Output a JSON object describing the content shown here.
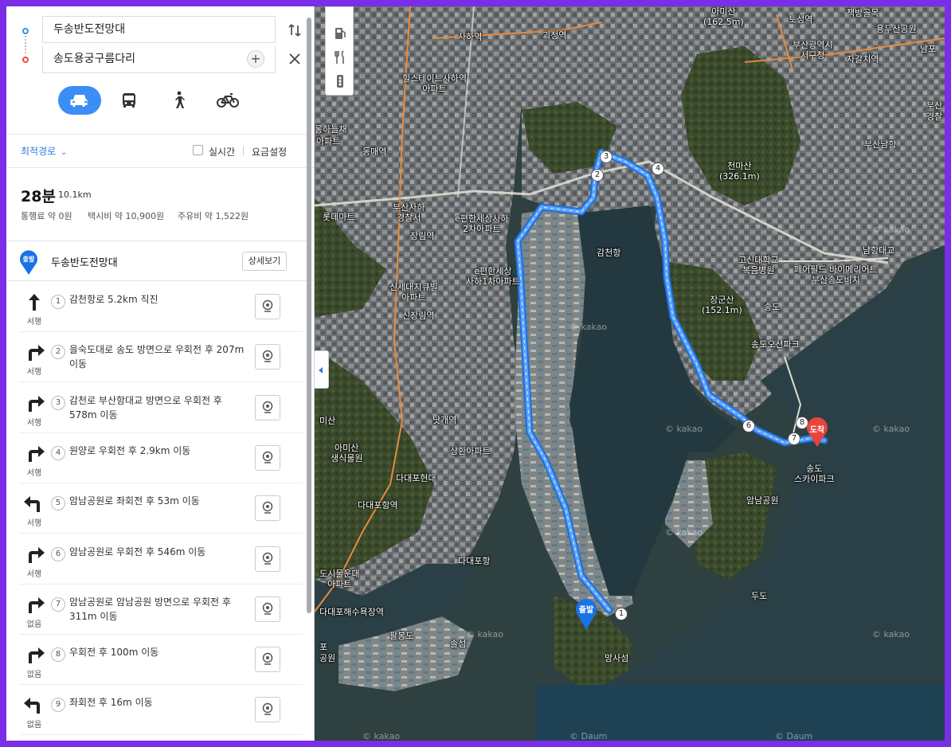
{
  "search": {
    "origin": "두송반도전망대",
    "destination": "송도용궁구름다리"
  },
  "modes": [
    "car",
    "bus",
    "walk",
    "bike"
  ],
  "options": {
    "route_type": "최적경로",
    "realtime": "실시간",
    "fare_settings": "요금설정"
  },
  "summary": {
    "time": "28분",
    "distance": "10.1km",
    "toll": "통행료 약 0원",
    "taxi": "택시비 약 10,900원",
    "fuel": "주유비 약 1,522원"
  },
  "start": {
    "badge": "출발",
    "name": "두송반도전망대",
    "detail_button": "상세보기"
  },
  "steps": [
    {
      "num": "1",
      "text": "감천항로 5.2km 직진",
      "dir": "서행",
      "icon": "straight-arrow-icon"
    },
    {
      "num": "2",
      "text": "을숙도대로 송도 방면으로 우회전 후 207m 이동",
      "dir": "서행",
      "icon": "turn-right-icon"
    },
    {
      "num": "3",
      "text": "감천로 부산항대교 방면으로 우회전 후 578m 이동",
      "dir": "서행",
      "icon": "turn-right-icon"
    },
    {
      "num": "4",
      "text": "원양로 우회전 후 2.9km 이동",
      "dir": "서행",
      "icon": "turn-right-icon"
    },
    {
      "num": "5",
      "text": "암남공원로 좌회전 후 53m 이동",
      "dir": "서행",
      "icon": "turn-left-icon"
    },
    {
      "num": "6",
      "text": "암남공원로 우회전 후 546m 이동",
      "dir": "서행",
      "icon": "turn-right-icon"
    },
    {
      "num": "7",
      "text": "암남공원로 암남공원 방면으로 우회전 후 311m 이동",
      "dir": "없음",
      "icon": "turn-right-icon"
    },
    {
      "num": "8",
      "text": "우회전 후 100m 이동",
      "dir": "없음",
      "icon": "turn-right-icon"
    },
    {
      "num": "9",
      "text": "좌회전 후 16m 이동",
      "dir": "없음",
      "icon": "turn-left-icon"
    }
  ],
  "map": {
    "labels": {
      "amisan_top": "아미산\n(162.5m)",
      "toseong": "토성역",
      "chaekbang": "책방골목",
      "yongdusan": "용두산공원",
      "saha_st": "사하역",
      "goejeong_st": "괴정역",
      "busan_seogu": "부산광역시\n서구청",
      "jagalchi": "자갈치역",
      "nampo": "남포",
      "hillstate": "힐스테이트사하역\n아파트",
      "ongha": "롱하늘채",
      "apt_l": "아파트",
      "dongmae": "동매역",
      "busan_port_s": "부산",
      "busan_port_s2": "경찰",
      "busan_nanghang": "부산남항",
      "cheonmasan": "천마산\n(326.1m)",
      "saha_police": "부산사하\n경찰서",
      "lotte": "롯데마트",
      "pyeonhan2": "e편한세상사하\n2차아파트",
      "jangrim": "장림역",
      "gamcheon_port": "감천항",
      "gosin_hosp": "고신대학교\n복음병원",
      "namhang_bridge": "남항대교",
      "pyeonhan1": "e편한세상\n사하1차아파트",
      "peoplefield": "페어필드 바이메리어트\n부산송도비치",
      "shinsegae": "신세대지큐빌\n아파트",
      "jangunsan": "장군산\n(152.1m)",
      "songdo1": "송도",
      "sinjangrim": "신장림역",
      "songdo_park": "송도오션파크",
      "misan": "미산",
      "naksong": "낫개역",
      "amisan_park": "아미산\n생식물원",
      "samhwan": "삼환아파트",
      "dadaepo_hyundai": "다대포현대",
      "songdo_sky": "송도\n스카이파크",
      "amnam": "암남공원",
      "dadaepo_port": "다대포항역",
      "dadaepo_hang": "다대포항",
      "dosi_apt": "도시물운대\n아파트",
      "dadaepo_beach": "다대포해수욕장역",
      "dudo": "두도",
      "palbongdo": "팔봉도",
      "solseom": "솔섬",
      "mangsaseom": "망사섬",
      "gongwon": "공원",
      "pae": "포",
      "kakao": "© kakao",
      "daum": "© Daum",
      "arrival": "도착",
      "departure": "출발"
    },
    "waypoints": [
      "1",
      "2",
      "3",
      "4",
      "6",
      "7",
      "8"
    ],
    "colors": {
      "route": "#3d8cf2",
      "arrival": "#e8443a",
      "departure": "#1a72e8"
    }
  }
}
